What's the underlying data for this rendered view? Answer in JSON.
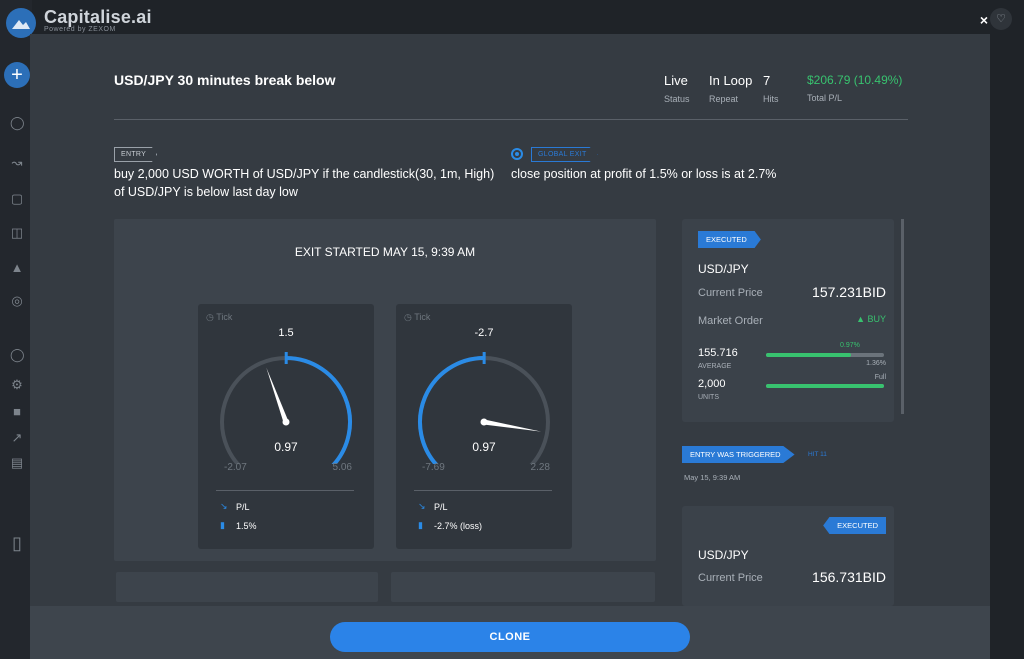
{
  "app": {
    "brand": "Capitalise.ai",
    "brand_sub": "Powered by ZEXOM",
    "close_glyph": "×"
  },
  "strategy": {
    "title": "USD/JPY 30 minutes break below",
    "stats": [
      {
        "value": "Live",
        "label": "Status"
      },
      {
        "value": "In Loop",
        "label": "Repeat"
      },
      {
        "value": "7",
        "label": "Hits"
      },
      {
        "value": "$206.79 (10.49%)",
        "label": "Total P/L"
      }
    ]
  },
  "entry": {
    "tag": "ENTRY",
    "line1": "buy 2,000 USD WORTH of USD/JPY if the candlestick(30, 1m, High)",
    "line2": "of USD/JPY is below last day low"
  },
  "exit": {
    "tag": "GLOBAL EXIT",
    "text": "close position at profit of 1.5% or loss is at 2.7%"
  },
  "panel": {
    "title": "EXIT STARTED MAY 15, 9:39 AM",
    "gauges": [
      {
        "tick_label": "Tick",
        "top": "1.5",
        "value_text": "0.97",
        "min": "-2.07",
        "max": "5.06",
        "value": 0.97,
        "lo": -2.07,
        "hi": 5.06,
        "threshold": 1.5,
        "legend1": "P/L",
        "legend2": "1.5%"
      },
      {
        "tick_label": "Tick",
        "top": "-2.7",
        "value_text": "0.97",
        "min": "-7.69",
        "max": "2.28",
        "value": 0.97,
        "lo": -7.69,
        "hi": 2.28,
        "threshold": -2.7,
        "legend1": "P/L",
        "legend2": "-2.7% (loss)"
      }
    ]
  },
  "order1": {
    "badge": "EXECUTED",
    "pair": "USD/JPY",
    "current_price_label": "Current Price",
    "current_price": "157.231BID",
    "order_type": "Market Order",
    "side": "BUY",
    "average": "155.716",
    "average_label": "AVERAGE",
    "progress_pct": "0.97%",
    "progress_value": 0.72,
    "target_pct": "1.36%",
    "units": "2,000",
    "units_label": "UNITS",
    "units_status": "Full",
    "units_value": 1.0
  },
  "trigger": {
    "badge": "ENTRY WAS TRIGGERED",
    "hit": "HIT 11",
    "time": "May 15, 9:39 AM"
  },
  "order2": {
    "badge": "EXECUTED",
    "pair": "USD/JPY",
    "current_price_label": "Current Price",
    "current_price": "156.731BID"
  },
  "footer": {
    "clone_label": "CLONE"
  },
  "colors": {
    "accent": "#2a8be6",
    "profit": "#38c26f",
    "modal_bg": "#353b42"
  }
}
